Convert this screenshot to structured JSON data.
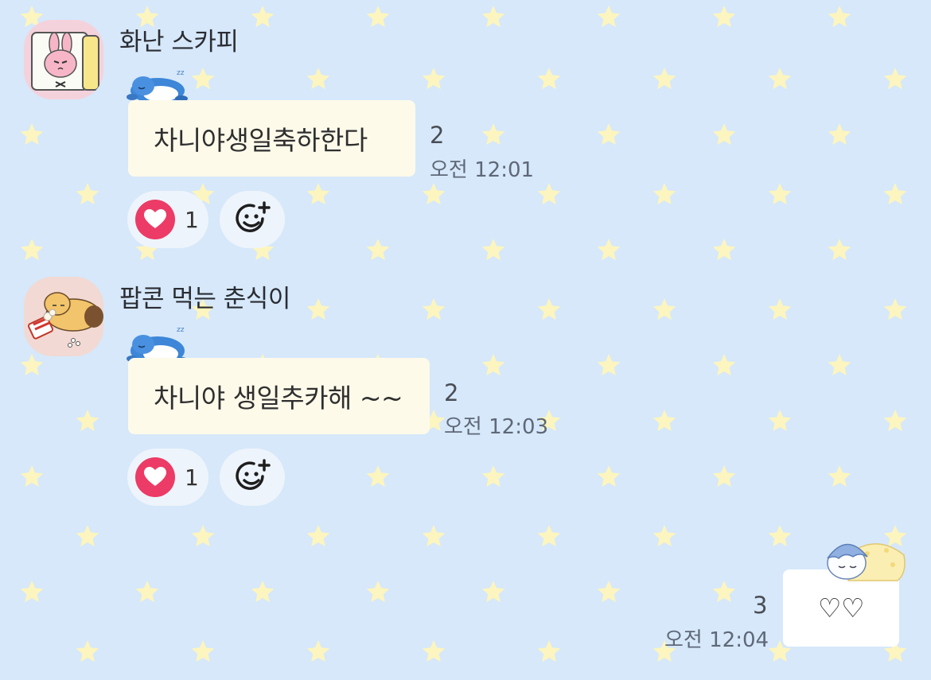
{
  "theme": {
    "background": "#d6e8fa",
    "bubble_other": "#fefaea",
    "bubble_mine": "#ffffff",
    "heart_color": "#ec3b66",
    "star_yellow": "#fcf5bf",
    "star_white": "#eaf3fc"
  },
  "messages": [
    {
      "sender": "화난 스카피",
      "avatar_icon": "angry-scarpy-bunny-avatar",
      "sticker_icon": "sleeping-penguin-icon",
      "text": "차니야생일축하한다",
      "unread": "2",
      "time": "오전 12:01",
      "reaction_icon": "heart-icon",
      "reaction_count": "1",
      "add_reaction_icon": "add-emoji-icon"
    },
    {
      "sender": "팝콘 먹는 춘식이",
      "avatar_icon": "popcorn-choonsik-avatar",
      "sticker_icon": "sleeping-penguin-icon",
      "text": "차니야 생일추카해 ~~",
      "unread": "2",
      "time": "오전 12:03",
      "reaction_icon": "heart-icon",
      "reaction_count": "1",
      "add_reaction_icon": "add-emoji-icon"
    }
  ],
  "my_message": {
    "sticker_icon": "sleeping-character-under-blanket-icon",
    "text": "♡♡",
    "unread": "3",
    "time": "오전 12:04"
  }
}
